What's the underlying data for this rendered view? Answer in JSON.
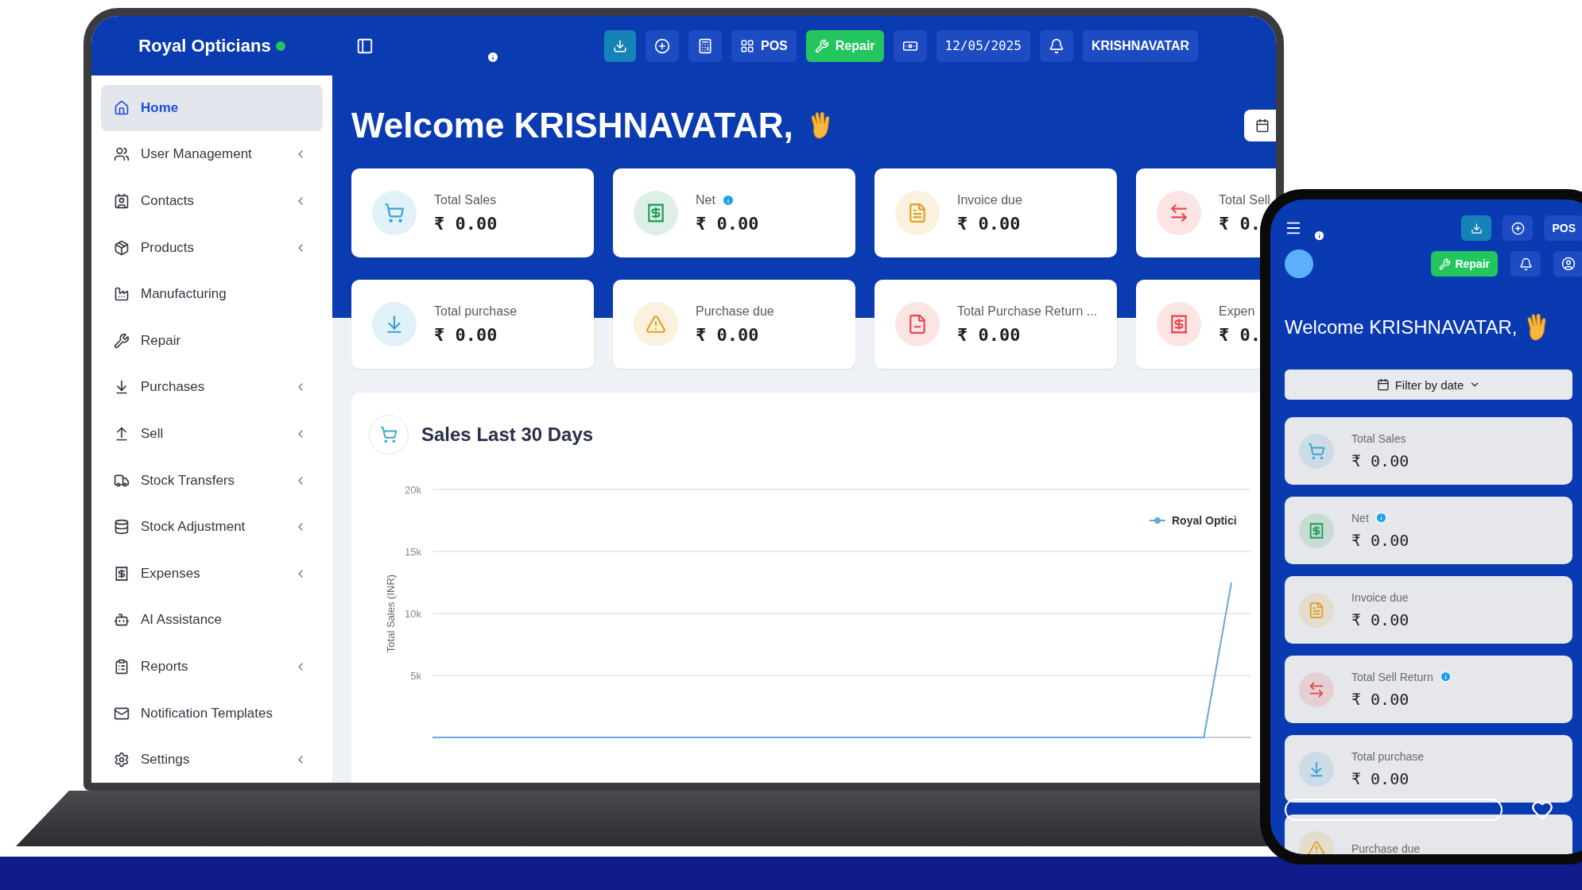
{
  "laptop": {
    "sidebar": {
      "brand": "Royal Opticians",
      "online": true,
      "items": [
        {
          "label": "Home",
          "selected": true,
          "submenu": false
        },
        {
          "label": "User Management",
          "selected": false,
          "submenu": true
        },
        {
          "label": "Contacts",
          "selected": false,
          "submenu": true
        },
        {
          "label": "Products",
          "selected": false,
          "submenu": true
        },
        {
          "label": "Manufacturing",
          "selected": false,
          "submenu": false
        },
        {
          "label": "Repair",
          "selected": false,
          "submenu": false
        },
        {
          "label": "Purchases",
          "selected": false,
          "submenu": true
        },
        {
          "label": "Sell",
          "selected": false,
          "submenu": true
        },
        {
          "label": "Stock Transfers",
          "selected": false,
          "submenu": true
        },
        {
          "label": "Stock Adjustment",
          "selected": false,
          "submenu": true
        },
        {
          "label": "Expenses",
          "selected": false,
          "submenu": true
        },
        {
          "label": "AI Assistance",
          "selected": false,
          "submenu": false
        },
        {
          "label": "Reports",
          "selected": false,
          "submenu": true
        },
        {
          "label": "Notification Templates",
          "selected": false,
          "submenu": false
        },
        {
          "label": "Settings",
          "selected": false,
          "submenu": true
        }
      ]
    },
    "topbar": [
      {
        "kind": "toggle"
      },
      {
        "kind": "info"
      },
      {
        "kind": "download"
      },
      {
        "kind": "add"
      },
      {
        "kind": "calculator"
      },
      {
        "kind": "pos",
        "label": "POS"
      },
      {
        "kind": "repair",
        "label": "Repair"
      },
      {
        "kind": "cash"
      },
      {
        "kind": "date",
        "label": "12/05/2025"
      },
      {
        "kind": "bell"
      },
      {
        "kind": "user",
        "label": "KRISHNAVATAR"
      }
    ],
    "welcome": "Welcome KRISHNAVATAR,",
    "cards": [
      {
        "kind": "cart",
        "label": "Total Sales",
        "value": "₹ 0.00",
        "info": false,
        "color": "#38a3d1"
      },
      {
        "kind": "receipt",
        "label": "Net",
        "value": "₹ 0.00",
        "info": true,
        "color": "#1f9d55"
      },
      {
        "kind": "invoice",
        "label": "Invoice due",
        "value": "₹ 0.00",
        "info": false,
        "color": "#e0a021"
      },
      {
        "kind": "swap",
        "label": "Total Sell",
        "value": "₹ 0.",
        "info": false,
        "color": "#e5484d"
      },
      {
        "kind": "download",
        "label": "Total purchase",
        "value": "₹ 0.00",
        "info": false,
        "color": "#38a3d1"
      },
      {
        "kind": "warning",
        "label": "Purchase due",
        "value": "₹ 0.00",
        "info": false,
        "color": "#e0a021"
      },
      {
        "kind": "return",
        "label": "Total Purchase Return ...",
        "value": "₹ 0.00",
        "info": false,
        "color": "#e5484d"
      },
      {
        "kind": "expense",
        "label": "Expen",
        "value": "₹ 0.",
        "info": false,
        "color": "#e5484d"
      }
    ],
    "chart": {
      "title": "Sales Last 30 Days",
      "chart_data": {
        "type": "line",
        "grid": true,
        "ylabel": "Total Sales (INR)",
        "ylim": [
          0,
          20000
        ],
        "yticks": [
          {
            "value": 5000,
            "label": "5k"
          },
          {
            "value": 10000,
            "label": "10k"
          },
          {
            "value": 15000,
            "label": "15k"
          },
          {
            "value": 20000,
            "label": "20k"
          }
        ],
        "series": [
          {
            "name": "Royal Optici",
            "color": "#6aa6dc",
            "values": [
              0,
              0,
              0,
              0,
              0,
              0,
              0,
              0,
              0,
              0,
              0,
              0,
              0,
              0,
              0,
              0,
              0,
              0,
              0,
              0,
              0,
              0,
              0,
              0,
              0,
              0,
              0,
              0,
              0,
              12500
            ]
          }
        ]
      }
    }
  },
  "phone": {
    "topbar": [
      {
        "kind": "menu"
      },
      {
        "kind": "info"
      },
      {
        "kind": "download"
      },
      {
        "kind": "add"
      },
      {
        "kind": "pos",
        "label": "POS"
      }
    ],
    "actions": [
      {
        "kind": "avatar"
      },
      {
        "kind": "repair",
        "label": "Repair"
      },
      {
        "kind": "bell"
      },
      {
        "kind": "user"
      }
    ],
    "welcome": "Welcome KRISHNAVATAR,",
    "filter": "Filter by date",
    "cards": [
      {
        "kind": "cart",
        "label": "Total Sales",
        "value": "₹ 0.00",
        "info": false,
        "color": "#38a3d1"
      },
      {
        "kind": "receipt",
        "label": "Net",
        "value": "₹ 0.00",
        "info": true,
        "color": "#1f9d55"
      },
      {
        "kind": "invoice",
        "label": "Invoice due",
        "value": "₹ 0.00",
        "info": false,
        "color": "#e0a021"
      },
      {
        "kind": "swap",
        "label": "Total Sell Return",
        "value": "₹ 0.00",
        "info": true,
        "color": "#e5484d"
      },
      {
        "kind": "download",
        "label": "Total purchase",
        "value": "₹ 0.00",
        "info": false,
        "color": "#38a3d1"
      },
      {
        "kind": "warning",
        "label": "Purchase due",
        "info": false,
        "color": "#e0a021"
      }
    ]
  }
}
